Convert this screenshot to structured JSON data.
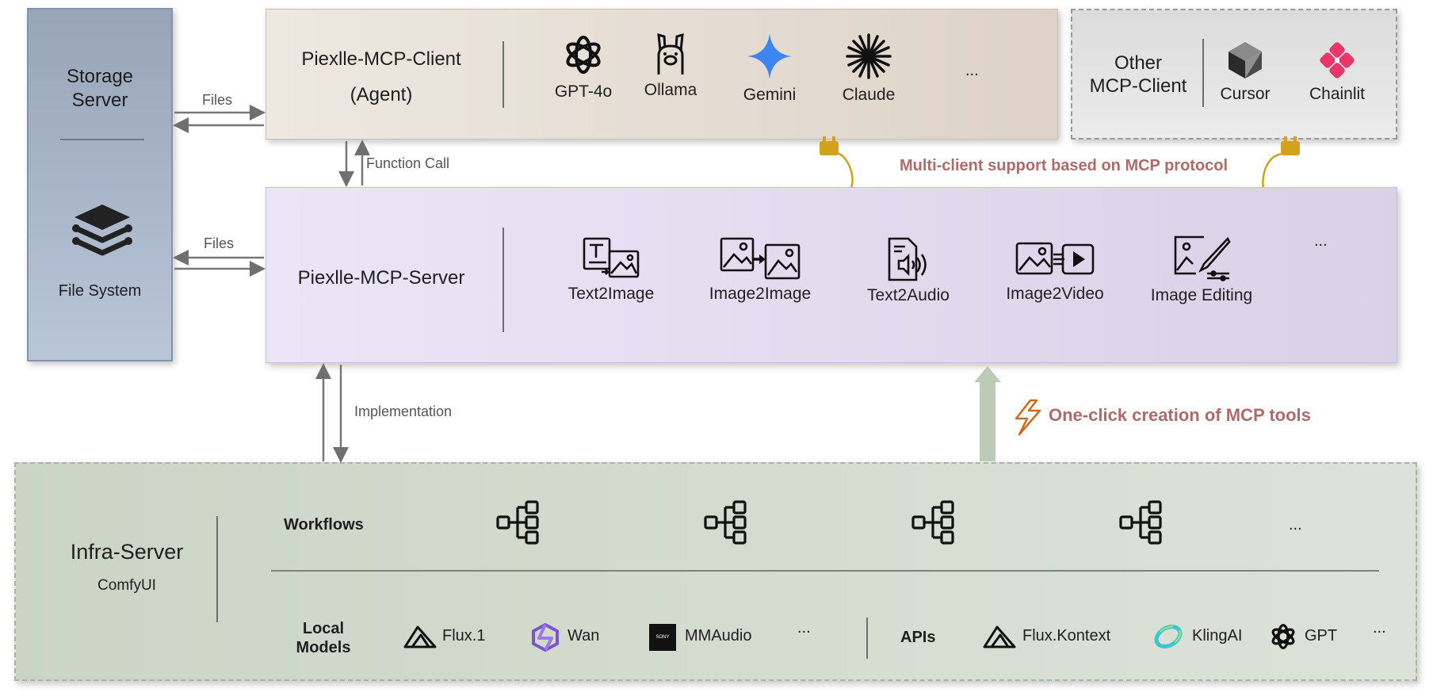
{
  "storage": {
    "title_line1": "Storage",
    "title_line2": "Server",
    "fs_label": "File System"
  },
  "client": {
    "title_line1": "Piexlle-MCP-Client",
    "title_line2": "(Agent)",
    "models": [
      {
        "name": "GPT-4o",
        "icon": "openai-icon"
      },
      {
        "name": "Ollama",
        "icon": "llama-icon"
      },
      {
        "name": "Gemini",
        "icon": "gemini-star-icon"
      },
      {
        "name": "Claude",
        "icon": "claude-burst-icon"
      }
    ],
    "more": "..."
  },
  "other_client": {
    "title_line1": "Other",
    "title_line2": "MCP-Client",
    "apps": [
      "Cursor",
      "Chainlit"
    ]
  },
  "server": {
    "title": "Piexlle-MCP-Server",
    "tools": [
      {
        "name": "Text2Image",
        "icon": "text-to-image-icon"
      },
      {
        "name": "Image2Image",
        "icon": "image-to-image-icon"
      },
      {
        "name": "Text2Audio",
        "icon": "text-to-audio-icon"
      },
      {
        "name": "Image2Video",
        "icon": "image-to-video-icon"
      },
      {
        "name": "Image Editing",
        "icon": "image-editing-icon"
      }
    ],
    "more": "..."
  },
  "connectors": {
    "files_top": "Files",
    "files_mid": "Files",
    "function_call": "Function Call",
    "implementation": "Implementation"
  },
  "annotations": {
    "multi_client": "Multi-client support based on MCP protocol",
    "one_click": "One-click creation of MCP tools"
  },
  "infra": {
    "title": "Infra-Server",
    "subtitle": "ComfyUI",
    "workflows_label": "Workflows",
    "workflows_more": "...",
    "local_models_line1": "Local",
    "local_models_line2": "Models",
    "local_models": [
      "Flux.1",
      "Wan",
      "MMAudio"
    ],
    "local_more": "...",
    "sony_text": "SONY",
    "apis_label": "APIs",
    "apis": [
      "Flux.Kontext",
      "KlingAI",
      "GPT"
    ],
    "apis_more": "..."
  },
  "colors": {
    "storage_bg": "#a9b7c9",
    "client_bg": "#e2dad0",
    "other_bg": "#e4e4e4",
    "server_bg": "#e4dff0",
    "infra_bg": "#d4dccf",
    "accent_red": "#b06a6a",
    "gemini_blue": "#3d86f2",
    "chainlit_pink": "#e8366b",
    "plug_gold": "#d4a21a"
  }
}
